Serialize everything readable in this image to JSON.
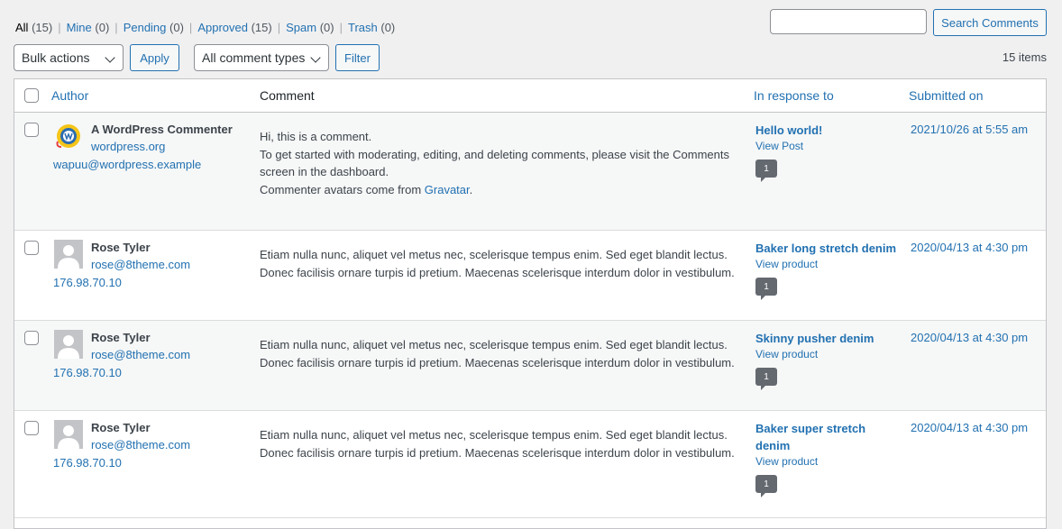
{
  "filters": [
    {
      "label": "All",
      "count": "(15)",
      "current": true
    },
    {
      "label": "Mine",
      "count": "(0)"
    },
    {
      "label": "Pending",
      "count": "(0)"
    },
    {
      "label": "Approved",
      "count": "(15)"
    },
    {
      "label": "Spam",
      "count": "(0)"
    },
    {
      "label": "Trash",
      "count": "(0)"
    }
  ],
  "filter_separator": "|",
  "search": {
    "value": "",
    "button": "Search Comments"
  },
  "tablenav": {
    "bulk_actions": "Bulk actions",
    "apply": "Apply",
    "comment_types": "All comment types",
    "filter": "Filter",
    "items_count": "15 items"
  },
  "columns": {
    "author": "Author",
    "comment": "Comment",
    "response": "In response to",
    "submitted": "Submitted on"
  },
  "rows": [
    {
      "avatar": "wapuu-avatar",
      "author_name": "A WordPress Commenter",
      "author_url": "wordpress.org",
      "author_email": "wapuu@wordpress.example",
      "comment_lines": [
        "Hi, this is a comment.",
        "To get started with moderating, editing, and deleting comments, please visit the Comments",
        "screen in the dashboard."
      ],
      "comment_last_prefix": "Commenter avatars come from ",
      "comment_last_link": "Gravatar",
      "comment_last_suffix": ".",
      "response_title": "Hello world!",
      "response_view": "View Post",
      "count": "1",
      "submitted": "2021/10/26 at 5:55 am"
    },
    {
      "avatar": "default-avatar",
      "author_name": "Rose Tyler",
      "author_email": "rose@8theme.com",
      "author_ip": "176.98.70.10",
      "comment_lines": [
        "Etiam nulla nunc, aliquet vel metus nec, scelerisque tempus enim. Sed eget blandit lectus.",
        "Donec facilisis ornare turpis id pretium. Maecenas scelerisque interdum dolor in vestibulum."
      ],
      "response_title": "Baker long stretch denim",
      "response_view": "View product",
      "count": "1",
      "submitted": "2020/04/13 at 4:30 pm"
    },
    {
      "avatar": "default-avatar",
      "author_name": "Rose Tyler",
      "author_email": "rose@8theme.com",
      "author_ip": "176.98.70.10",
      "comment_lines": [
        "Etiam nulla nunc, aliquet vel metus nec, scelerisque tempus enim. Sed eget blandit lectus.",
        "Donec facilisis ornare turpis id pretium. Maecenas scelerisque interdum dolor in vestibulum."
      ],
      "response_title": "Skinny pusher denim",
      "response_view": "View product",
      "count": "1",
      "submitted": "2020/04/13 at 4:30 pm"
    },
    {
      "avatar": "default-avatar",
      "author_name": "Rose Tyler",
      "author_email": "rose@8theme.com",
      "author_ip": "176.98.70.10",
      "comment_lines": [
        "Etiam nulla nunc, aliquet vel metus nec, scelerisque tempus enim. Sed eget blandit lectus.",
        "Donec facilisis ornare turpis id pretium. Maecenas scelerisque interdum dolor in vestibulum."
      ],
      "response_title_lines": [
        "Baker super stretch",
        "denim"
      ],
      "response_view": "View product",
      "count": "1",
      "submitted": "2020/04/13 at 4:30 pm"
    }
  ]
}
